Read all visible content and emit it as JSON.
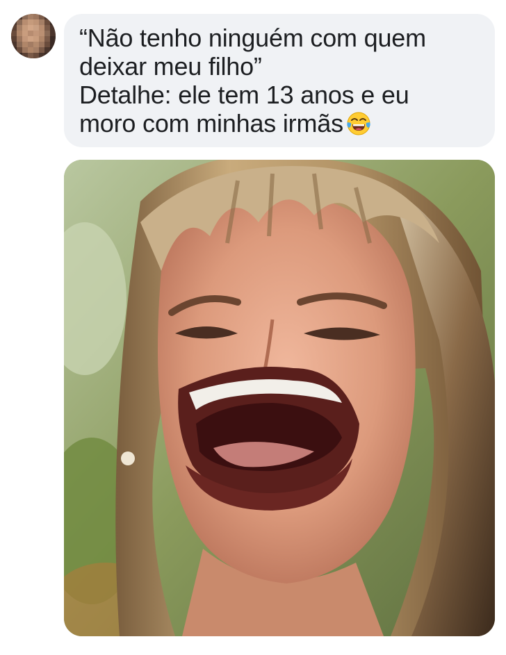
{
  "message": {
    "lines": [
      "“Não tenho ninguém com quem",
      "deixar meu filho”",
      "Detalhe: ele tem 13 anos e eu",
      "moro com minhas irmãs"
    ],
    "emoji_icon": "face-with-tears-of-joy-icon"
  },
  "colors": {
    "bubble_background": "#f0f2f5",
    "text": "#1c1e21",
    "page_background": "#ffffff"
  }
}
